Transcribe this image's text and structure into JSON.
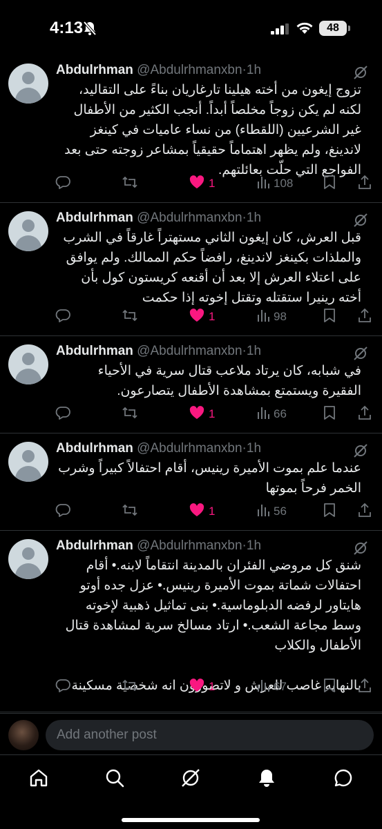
{
  "status_bar": {
    "time": "4:13",
    "battery": "48"
  },
  "author": {
    "name": "Abdulrhman",
    "handle": "@Abdulrhmanxbn",
    "separator": "·"
  },
  "posts": [
    {
      "time": "1h",
      "text": "تزوج إيغون من أخته هيلينا تارغاريان بناءً على التقاليد، لكنه لم يكن زوجاً مخلصاً أبداً. أنجب الكثير من الأطفال غير الشرعيين (اللقطاء) من نساء عاميات في كينغز لاندينغ، ولم يظهر اهتماماً حقيقياً بمشاعر زوجته حتى بعد الفواجع التي حلّت بعائلتهم.",
      "likes": "1",
      "views": "108"
    },
    {
      "time": "1h",
      "text": "قبل العرش، كان إيغون الثاني مستهتراً غارقاً في الشرب والملذات بكينغز لاندينغ، رافضاً حكم الممالك. ولم يوافق على اعتلاء العرش إلا بعد أن أقنعه كريستون كول بأن أخته رينيرا ستقتله وتقتل إخوته إذا حكمت",
      "likes": "1",
      "views": "98"
    },
    {
      "time": "1h",
      "text": "في شبابه، كان يرتاد ملاعب قتال سرية في الأحياء الفقيرة ويستمتع بمشاهدة الأطفال يتصارعون.",
      "likes": "1",
      "views": "66"
    },
    {
      "time": "1h",
      "text": "عندما علم بموت الأميرة رينيس، أقام احتفالاً كبيراً وشرب الخمر فرحاً بموتها",
      "likes": "1",
      "views": "56"
    },
    {
      "time": "1h",
      "text": "شنق كل مروضي الفئران بالمدينة انتقاماً لابنه.• أقام احتفالات شماتة بموت الأميرة رينيس.• عزل جده أوتو هايتاور لرفضه الدبلوماسية.• بنى تماثيل ذهبية لإخوته وسط مجاعة الشعب.• ارتاد مسالخ سرية لمشاهدة قتال الأطفال والكلاب\n\nبالنهايه غاصب للعرش و لاتصورون انه شخصية مسكينة",
      "likes": "1",
      "views": "67"
    }
  ],
  "composer": {
    "placeholder": "Add another post"
  },
  "icons": {
    "reply": "reply-icon",
    "repost": "repost-icon",
    "like": "heart-icon",
    "views": "views-icon",
    "bookmark": "bookmark-icon",
    "share": "share-icon",
    "grok": "grok-icon",
    "home": "home-icon",
    "search": "search-icon",
    "notifications": "bell-icon",
    "messages": "messages-icon"
  },
  "colors": {
    "background": "#000000",
    "like": "#f91880",
    "muted": "#71767b",
    "text": "#e7e9ea",
    "divider": "#2f3336"
  }
}
